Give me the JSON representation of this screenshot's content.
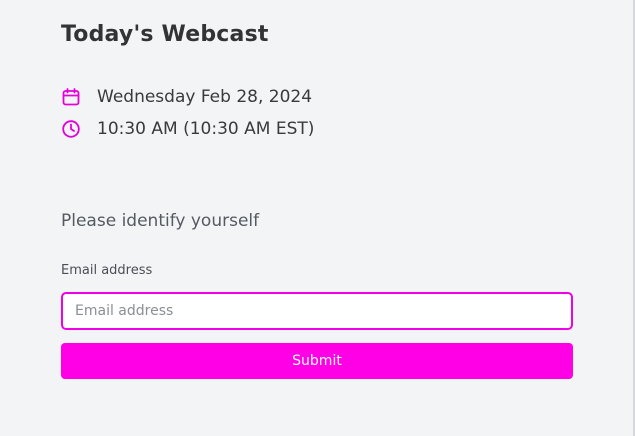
{
  "event": {
    "title": "Today's Webcast",
    "date": "Wednesday Feb 28, 2024",
    "time": "10:30 AM (10:30 AM EST)",
    "date_icon": "calendar-icon",
    "time_icon": "clock-icon"
  },
  "form": {
    "heading": "Please identify yourself",
    "email_label": "Email address",
    "email_placeholder": "Email address",
    "email_value": "",
    "submit_label": "Submit"
  },
  "colors": {
    "accent": "#ff00e6",
    "background": "#f3f4f6",
    "text": "#333333"
  }
}
